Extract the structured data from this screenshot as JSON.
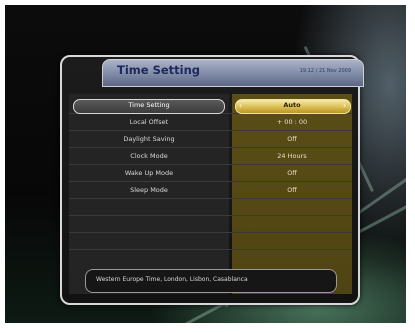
{
  "header": {
    "title": "Time Setting",
    "datetime": "19:12 / 21 Nov 2009"
  },
  "menu": {
    "rows": [
      {
        "label": "Time Setting",
        "value": "Auto",
        "selected": true
      },
      {
        "label": "Local Offset",
        "value": "+ 00 : 00"
      },
      {
        "label": "Daylight Saving",
        "value": "Off"
      },
      {
        "label": "Clock Mode",
        "value": "24 Hours"
      },
      {
        "label": "Wake Up Mode",
        "value": "Off"
      },
      {
        "label": "Sleep Mode",
        "value": "Off"
      }
    ]
  },
  "info": {
    "text": "Western Europe Time, London, Lisbon, Casablanca"
  },
  "icons": {
    "left": "chevron-left-icon",
    "right": "chevron-right-icon"
  }
}
